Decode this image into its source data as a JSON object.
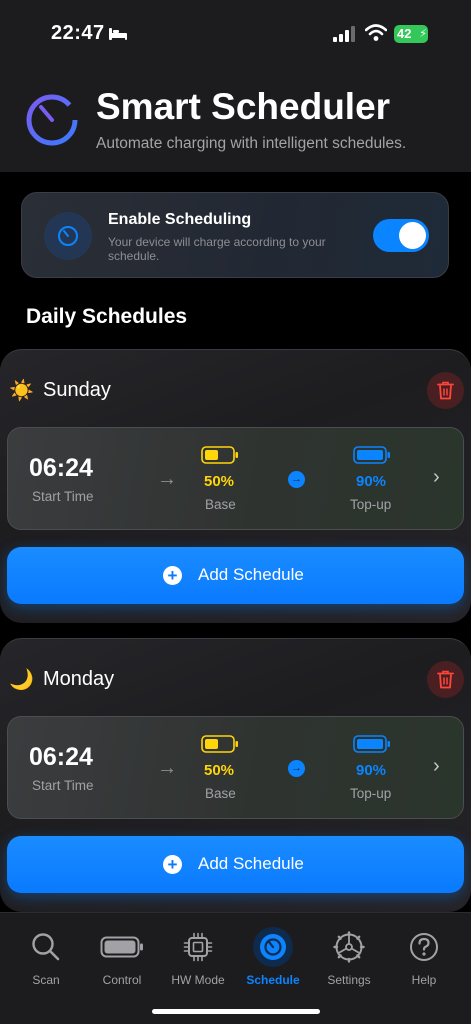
{
  "status_bar": {
    "time": "22:47",
    "battery": "42"
  },
  "header": {
    "title": "Smart Scheduler",
    "subtitle": "Automate charging with intelligent schedules."
  },
  "enable": {
    "title": "Enable Scheduling",
    "description": "Your device will charge according to your schedule.",
    "enabled": true
  },
  "section_title": "Daily Schedules",
  "days": [
    {
      "icon": "sun-icon",
      "glyph": "☀️",
      "name": "Sunday",
      "schedule": {
        "start_time": "06:24",
        "start_label": "Start Time",
        "base_value": "50%",
        "base_label": "Base",
        "topup_value": "90%",
        "topup_label": "Top-up"
      },
      "add_label": "Add Schedule"
    },
    {
      "icon": "moon-icon",
      "glyph": "🌙",
      "name": "Monday",
      "schedule": {
        "start_time": "06:24",
        "start_label": "Start Time",
        "base_value": "50%",
        "base_label": "Base",
        "topup_value": "90%",
        "topup_label": "Top-up"
      },
      "add_label": "Add Schedule"
    }
  ],
  "tabs": [
    {
      "label": "Scan",
      "icon": "search-icon",
      "active": false
    },
    {
      "label": "Control",
      "icon": "battery-icon",
      "active": false
    },
    {
      "label": "HW Mode",
      "icon": "chip-icon",
      "active": false
    },
    {
      "label": "Schedule",
      "icon": "timer-icon",
      "active": true
    },
    {
      "label": "Settings",
      "icon": "settings-icon",
      "active": false
    },
    {
      "label": "Help",
      "icon": "help-icon",
      "active": false
    }
  ],
  "colors": {
    "accent": "#0a84ff",
    "base_yellow": "#ffd60a",
    "toggle_on": "#0a84ff",
    "battery_green": "#34c759",
    "delete_red": "#ff453a"
  }
}
